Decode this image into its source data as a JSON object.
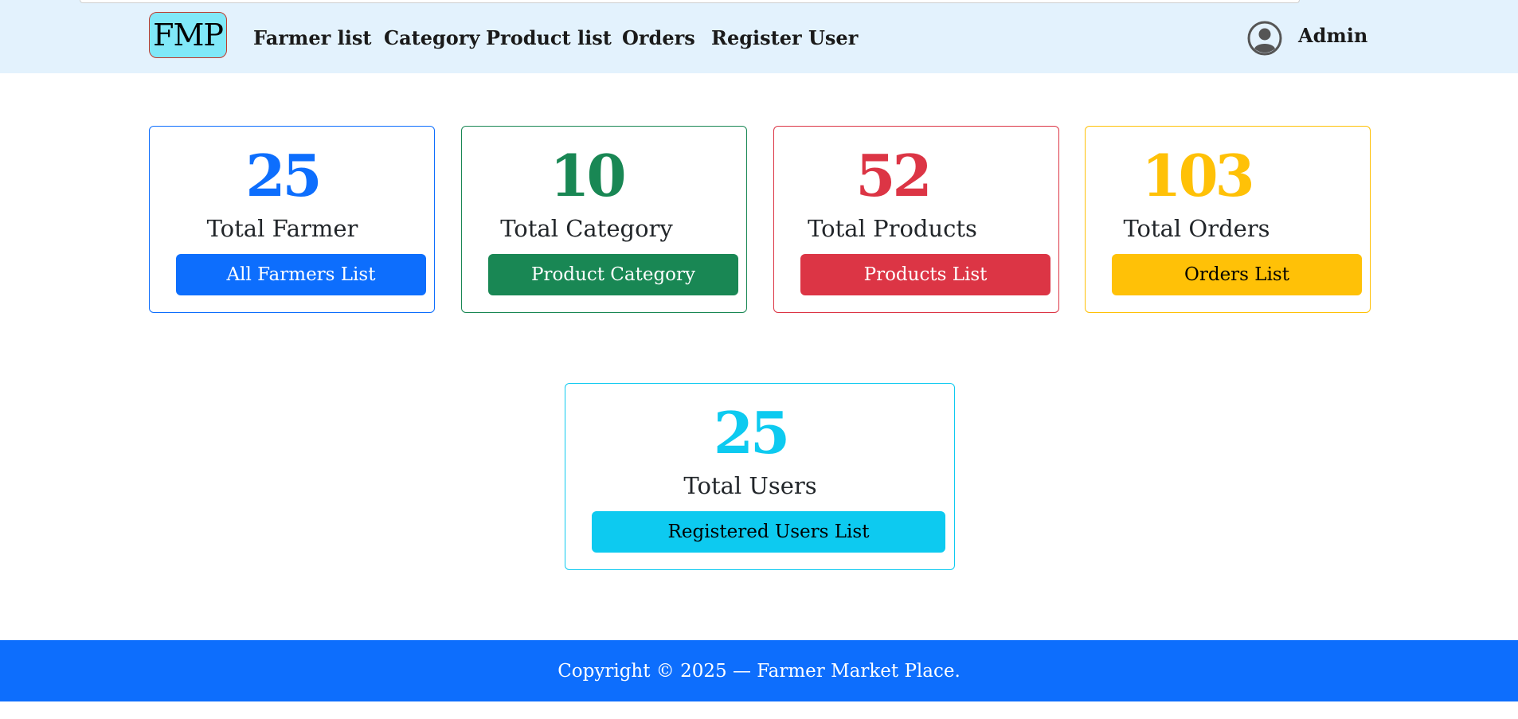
{
  "app": {
    "brand": "FMP",
    "accent_color": "#0d6efd"
  },
  "nav": {
    "items": [
      {
        "label": "Farmer list"
      },
      {
        "label": "Category"
      },
      {
        "label": "Product list"
      },
      {
        "label": "Orders"
      },
      {
        "label": "Register User"
      }
    ],
    "user": {
      "icon": "user-circle-icon",
      "name": "Admin"
    }
  },
  "cards": [
    {
      "count": "25",
      "label": "Total Farmer",
      "button": "All Farmers List",
      "color": "#0d6efd",
      "button_text_color": "#ffffff"
    },
    {
      "count": "10",
      "label": "Total Category",
      "button": "Product Category",
      "color": "#198754",
      "button_text_color": "#ffffff"
    },
    {
      "count": "52",
      "label": "Total Products",
      "button": "Products List",
      "color": "#dc3545",
      "button_text_color": "#ffffff"
    },
    {
      "count": "103",
      "label": "Total Orders",
      "button": "Orders List",
      "color": "#ffc107",
      "button_text_color": "#000000"
    },
    {
      "count": "25",
      "label": "Total Users",
      "button": "Registered Users List",
      "color": "#0dcaf0",
      "button_text_color": "#000000"
    }
  ],
  "footer": {
    "text": "Copyright © 2025 — Farmer Market Place."
  }
}
